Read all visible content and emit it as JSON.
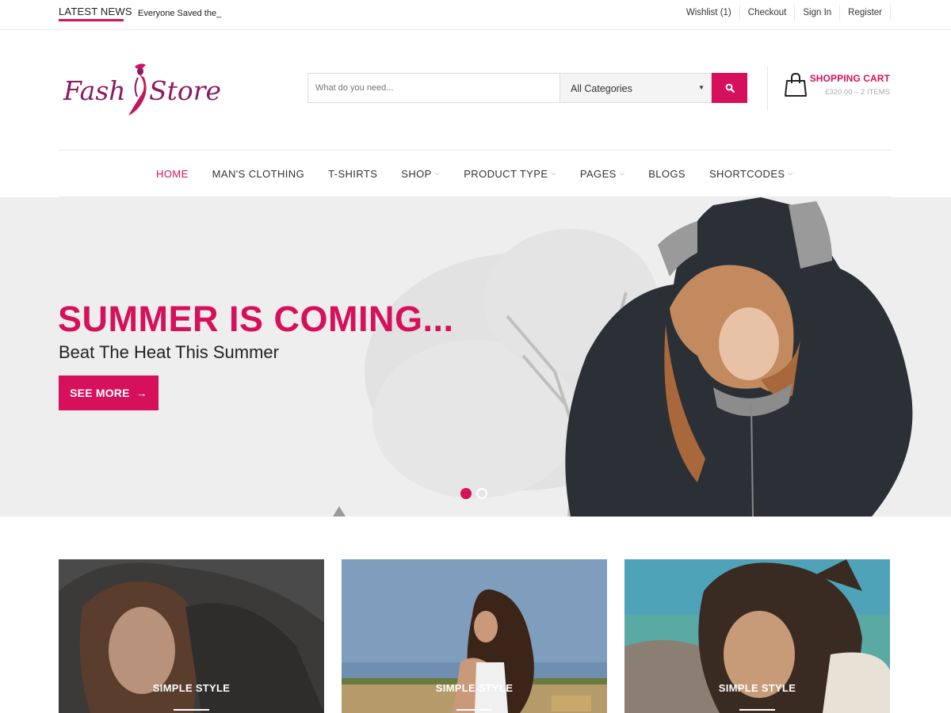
{
  "topbar": {
    "news_label": "LATEST NEWS",
    "news_text": "Everyone Saved the_",
    "links": [
      "Wishlist (1)",
      "Checkout",
      "Sign In",
      "Register"
    ]
  },
  "header": {
    "logo_text_left": "Fash",
    "logo_text_right": "Store",
    "search_placeholder": "What do you need...",
    "category_selected": "All Categories",
    "cart_title": "SHOPPING CART",
    "cart_summary": "£320.00 – 2 ITEMS"
  },
  "nav": {
    "items": [
      "HOME",
      "MAN'S CLOTHING",
      "T-SHIRTS",
      "SHOP",
      "PRODUCT TYPE",
      "PAGES",
      "BLOGS",
      "SHORTCODES"
    ]
  },
  "hero": {
    "title": "SUMMER IS COMING...",
    "subtitle": "Beat The Heat This Summer",
    "button": "SEE MORE",
    "button_arrow": "→",
    "active_slide": 1,
    "slide_count": 2
  },
  "cards": [
    {
      "label": "SIMPLE STYLE"
    },
    {
      "label": "SIMPLE STYLE"
    },
    {
      "label": "SIMPLE STYLE"
    }
  ],
  "colors": {
    "accent": "#d6105a",
    "text": "#333333",
    "hero_bg": "#eeeeee"
  },
  "icons": {
    "search": "search-icon",
    "cart": "shopping-bag-icon",
    "dropdown": "chevron-down-icon",
    "arrow": "arrow-right-icon"
  }
}
